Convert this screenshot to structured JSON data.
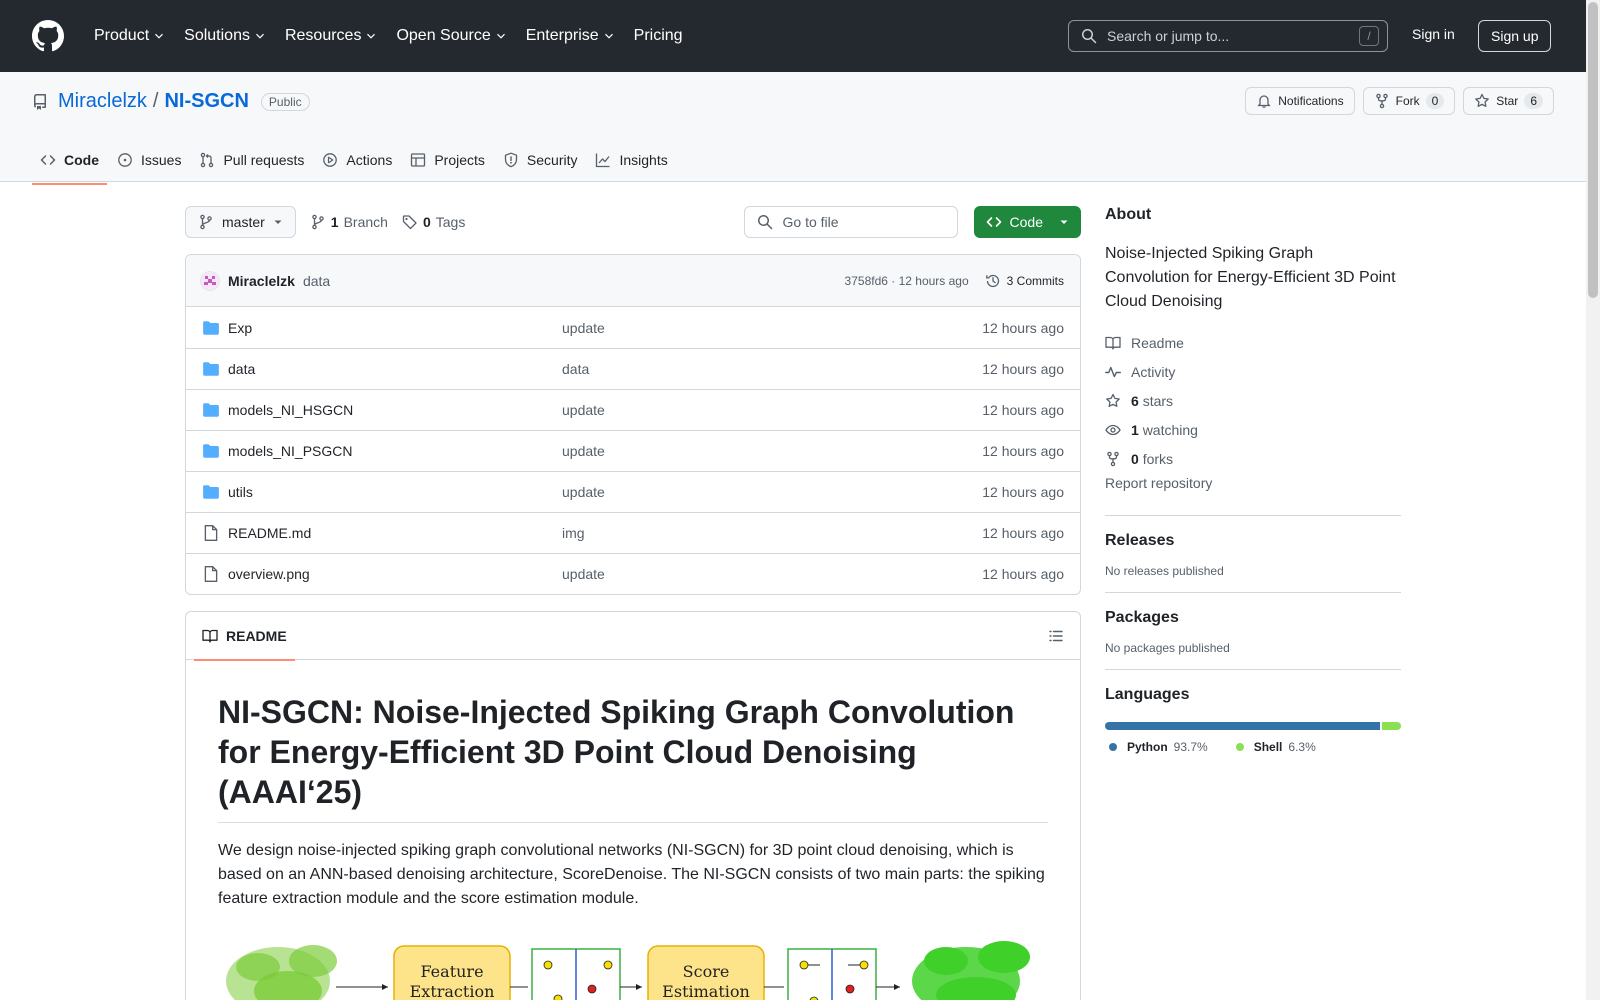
{
  "header": {
    "nav": [
      {
        "label": "Product",
        "has_menu": true
      },
      {
        "label": "Solutions",
        "has_menu": true
      },
      {
        "label": "Resources",
        "has_menu": true
      },
      {
        "label": "Open Source",
        "has_menu": true
      },
      {
        "label": "Enterprise",
        "has_menu": true
      },
      {
        "label": "Pricing",
        "has_menu": false
      }
    ],
    "search_placeholder": "Search or jump to...",
    "search_shortcut": "/",
    "sign_in": "Sign in",
    "sign_up": "Sign up"
  },
  "repo": {
    "owner": "Miraclelzk",
    "separator": "/",
    "name": "NI-SGCN",
    "visibility": "Public",
    "notifications_label": "Notifications",
    "fork_label": "Fork",
    "fork_count": "0",
    "star_label": "Star",
    "star_count": "6"
  },
  "tabs": [
    {
      "label": "Code",
      "icon": "code-icon",
      "active": true
    },
    {
      "label": "Issues",
      "icon": "issue-icon",
      "active": false
    },
    {
      "label": "Pull requests",
      "icon": "pull-request-icon",
      "active": false
    },
    {
      "label": "Actions",
      "icon": "play-icon",
      "active": false
    },
    {
      "label": "Projects",
      "icon": "table-icon",
      "active": false
    },
    {
      "label": "Security",
      "icon": "shield-icon",
      "active": false
    },
    {
      "label": "Insights",
      "icon": "graph-icon",
      "active": false
    }
  ],
  "toolbar": {
    "branch": "master",
    "branch_count": "1",
    "branch_label": "Branch",
    "tag_count": "0",
    "tag_label": "Tags",
    "go_to_file": "Go to file",
    "code_button": "Code"
  },
  "last_commit": {
    "author": "Miraclelzk",
    "message": "data",
    "hash_time": "3758fd6 · 12 hours ago",
    "commits_label": "3 Commits"
  },
  "files": [
    {
      "name": "Exp",
      "type": "dir",
      "message": "update",
      "time": "12 hours ago"
    },
    {
      "name": "data",
      "type": "dir",
      "message": "data",
      "time": "12 hours ago"
    },
    {
      "name": "models_NI_HSGCN",
      "type": "dir",
      "message": "update",
      "time": "12 hours ago"
    },
    {
      "name": "models_NI_PSGCN",
      "type": "dir",
      "message": "update",
      "time": "12 hours ago"
    },
    {
      "name": "utils",
      "type": "dir",
      "message": "update",
      "time": "12 hours ago"
    },
    {
      "name": "README.md",
      "type": "file",
      "message": "img",
      "time": "12 hours ago"
    },
    {
      "name": "overview.png",
      "type": "file",
      "message": "update",
      "time": "12 hours ago"
    }
  ],
  "readme": {
    "tab_label": "README",
    "title": "NI-SGCN: Noise-Injected Spiking Graph Convolution for Energy-Efficient 3D Point Cloud Denoising (AAAI‘25)",
    "paragraph": "We design noise-injected spiking graph convolutional networks (NI-SGCN) for 3D point cloud denoising, which is based on an ANN-based denoising architecture, ScoreDenoise. The NI-SGCN consists of two main parts: the spiking feature extraction module and the score estimation module.",
    "figure": {
      "box1_line1": "Feature",
      "box1_line2": "Extraction",
      "box2_line1": "Score",
      "box2_line2": "Estimation"
    }
  },
  "sidebar": {
    "about_heading": "About",
    "description": "Noise-Injected Spiking Graph Convolution for Energy-Efficient 3D Point Cloud Denoising",
    "readme_link": "Readme",
    "activity_link": "Activity",
    "stars_count": "6",
    "stars_label": "stars",
    "watching_count": "1",
    "watching_label": "watching",
    "forks_count": "0",
    "forks_label": "forks",
    "report": "Report repository",
    "releases_heading": "Releases",
    "releases_empty": "No releases published",
    "packages_heading": "Packages",
    "packages_empty": "No packages published",
    "languages_heading": "Languages",
    "languages": [
      {
        "name": "Python",
        "percent": "93.7%",
        "value": 93.7,
        "color": "#3572A5"
      },
      {
        "name": "Shell",
        "percent": "6.3%",
        "value": 6.3,
        "color": "#89e051"
      }
    ]
  },
  "colors": {
    "header_bg": "#24292f",
    "link": "#0969da",
    "primary_button": "#1f883d",
    "active_tab_underline": "#fd8c73",
    "folder": "#54aeff"
  }
}
